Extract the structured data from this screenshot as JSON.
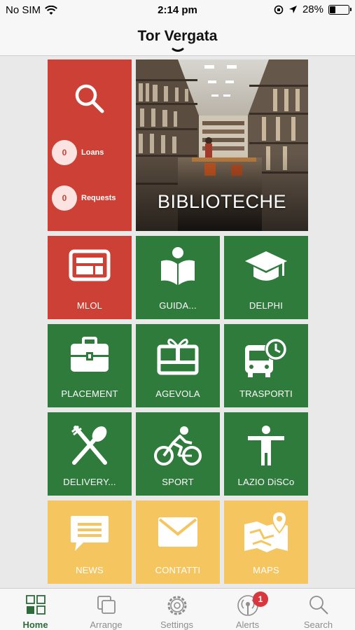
{
  "status_bar": {
    "carrier": "No SIM",
    "time": "2:14 pm",
    "battery": "28%",
    "battery_level": 0.28
  },
  "header": {
    "title": "Tor Vergata"
  },
  "library_tile": {
    "title": "BIBLIOTECHE",
    "loans": {
      "count": "0",
      "label": "Loans"
    },
    "requests": {
      "count": "0",
      "label": "Requests"
    }
  },
  "tiles": [
    {
      "label": "MLOL",
      "icon": "ebook-reader-icon",
      "color": "#cd4035"
    },
    {
      "label": "GUIDA...",
      "icon": "guide-book-icon",
      "color": "#2f7b3c"
    },
    {
      "label": "DELPHI",
      "icon": "graduation-cap-icon",
      "color": "#2f7b3c"
    },
    {
      "label": "PLACEMENT",
      "icon": "briefcase-icon",
      "color": "#2f7b3c"
    },
    {
      "label": "AGEVOLA",
      "icon": "gift-card-icon",
      "color": "#2f7b3c"
    },
    {
      "label": "TRASPORTI",
      "icon": "bus-clock-icon",
      "color": "#2f7b3c"
    },
    {
      "label": "DELIVERY...",
      "icon": "fork-spoon-icon",
      "color": "#2f7b3c"
    },
    {
      "label": "SPORT",
      "icon": "cyclist-icon",
      "color": "#2f7b3c"
    },
    {
      "label": "LAZIO DiSCo",
      "icon": "person-icon",
      "color": "#2f7b3c"
    },
    {
      "label": "NEWS",
      "icon": "chat-bubble-icon",
      "color": "#f5c560"
    },
    {
      "label": "CONTATTI",
      "icon": "envelope-icon",
      "color": "#f5c560"
    },
    {
      "label": "MAPS",
      "icon": "map-pin-icon",
      "color": "#f5c560"
    }
  ],
  "tab_bar": {
    "items": [
      {
        "label": "Home",
        "icon": "home-grid-icon"
      },
      {
        "label": "Arrange",
        "icon": "arrange-icon"
      },
      {
        "label": "Settings",
        "icon": "gear-icon"
      },
      {
        "label": "Alerts",
        "icon": "broadcast-icon",
        "badge": "1"
      },
      {
        "label": "Search",
        "icon": "search-icon"
      }
    ]
  }
}
